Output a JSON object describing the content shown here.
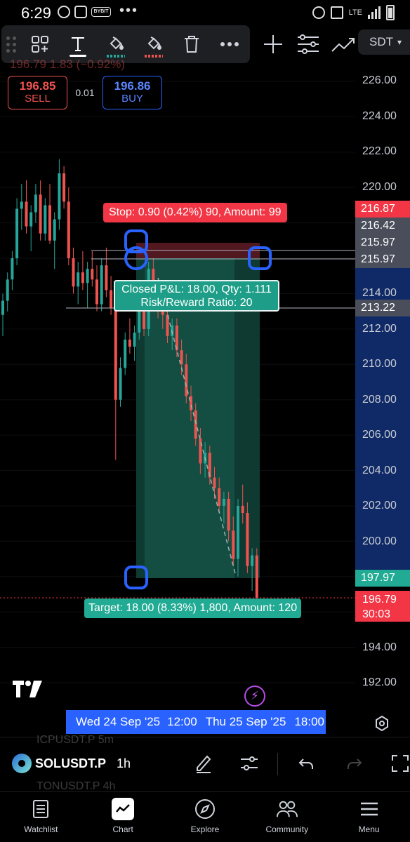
{
  "status_bar": {
    "time": "6:29",
    "carrier_badge": "BYBIT",
    "overflow": "•••",
    "network": "LTE"
  },
  "toolbar": {
    "tools": [
      "grid-add-icon",
      "text-icon",
      "fill-green-icon",
      "fill-red-icon",
      "trash-icon",
      "more-icon"
    ],
    "side_tools": [
      "crosshair-icon",
      "object-tree-icon",
      "drawing-icon"
    ]
  },
  "symbol_tag": {
    "label": "SDT",
    "caret": "▾"
  },
  "ohlc_ghost": "196.79   1.83 (−0.92%)",
  "trade": {
    "sell_price": "196.85",
    "sell_label": "SELL",
    "spread": "0.01",
    "buy_price": "196.86",
    "buy_label": "BUY"
  },
  "position": {
    "stop_label": "Stop: 0.90 (0.42%) 90, Amount: 99",
    "pnl_line1": "Closed P&L: 18.00, Qty: 1.111",
    "pnl_line2": "Risk/Reward Ratio: 20",
    "target_label": "Target: 18.00 (8.33%) 1,800, Amount: 120"
  },
  "price_axis": {
    "ticks": [
      "226.00",
      "224.00",
      "222.00",
      "220.00",
      "214.00",
      "212.00",
      "210.00",
      "208.00",
      "206.00",
      "204.00",
      "202.00",
      "200.00",
      "194.00",
      "192.00"
    ],
    "stop_price": "216.87",
    "upper_price": "216.42",
    "entry_price_1": "215.97",
    "entry_price_2": "215.97",
    "marker_price": "213.22",
    "target_price": "197.97",
    "last_price": "196.79",
    "countdown": "30:03"
  },
  "time_axis": {
    "labels": [
      "Wed 24 Sep '25",
      "12:00",
      "Thu 25 Sep '25",
      "18:00"
    ]
  },
  "symbol_bar": {
    "ghost_top": "ICPUSDT.P   5m",
    "symbol": "SOLUSDT.P",
    "timeframe": "1h",
    "ghost_bottom": "TONUSDT.P   4h"
  },
  "bottom_nav": [
    {
      "label": "Watchlist",
      "icon": "watchlist-icon"
    },
    {
      "label": "Chart",
      "icon": "chart-icon"
    },
    {
      "label": "Explore",
      "icon": "compass-icon"
    },
    {
      "label": "Community",
      "icon": "community-icon"
    },
    {
      "label": "Menu",
      "icon": "menu-icon"
    }
  ],
  "chart_data": {
    "type": "candlestick",
    "symbol": "SOLUSDT.P",
    "timeframe": "1h",
    "ylim": [
      191,
      228
    ],
    "colors": {
      "up": "#26a69a",
      "down": "#ef5350"
    },
    "candles": [
      [
        212.8,
        214.0,
        211.6,
        213.6
      ],
      [
        213.6,
        215.2,
        213.0,
        214.8
      ],
      [
        214.8,
        216.4,
        214.2,
        216.0
      ],
      [
        216.0,
        219.4,
        215.6,
        218.8
      ],
      [
        218.8,
        220.2,
        217.6,
        219.2
      ],
      [
        219.2,
        220.4,
        217.4,
        217.8
      ],
      [
        217.8,
        219.0,
        216.4,
        218.6
      ],
      [
        218.6,
        220.2,
        218.0,
        219.6
      ],
      [
        219.6,
        220.4,
        217.0,
        217.4
      ],
      [
        217.4,
        219.4,
        217.0,
        219.0
      ],
      [
        219.0,
        220.2,
        216.8,
        217.0
      ],
      [
        217.0,
        218.6,
        215.4,
        218.2
      ],
      [
        218.2,
        221.6,
        217.6,
        220.8
      ],
      [
        220.8,
        221.2,
        218.8,
        219.2
      ],
      [
        219.2,
        220.0,
        215.6,
        216.0
      ],
      [
        216.0,
        216.6,
        214.0,
        214.4
      ],
      [
        214.4,
        215.8,
        213.4,
        215.2
      ],
      [
        215.2,
        216.4,
        214.2,
        214.6
      ],
      [
        214.6,
        215.8,
        213.2,
        215.4
      ],
      [
        215.4,
        216.4,
        214.4,
        214.8
      ],
      [
        214.8,
        215.6,
        213.0,
        213.4
      ],
      [
        213.4,
        216.0,
        213.0,
        215.6
      ],
      [
        215.6,
        216.6,
        213.8,
        214.2
      ],
      [
        214.2,
        215.0,
        212.8,
        213.2
      ],
      [
        213.2,
        214.0,
        204.6,
        208.0
      ],
      [
        208.0,
        210.4,
        207.6,
        209.8
      ],
      [
        209.8,
        211.8,
        209.4,
        211.4
      ],
      [
        211.4,
        212.6,
        210.6,
        211.0
      ],
      [
        211.0,
        212.2,
        210.2,
        211.8
      ],
      [
        211.8,
        213.8,
        211.4,
        213.4
      ],
      [
        213.4,
        214.2,
        211.6,
        212.0
      ],
      [
        212.0,
        215.8,
        211.6,
        215.4
      ],
      [
        215.4,
        216.0,
        213.6,
        214.0
      ],
      [
        214.0,
        214.6,
        212.6,
        213.0
      ],
      [
        213.0,
        213.6,
        212.0,
        212.8
      ],
      [
        212.8,
        213.4,
        211.2,
        211.6
      ],
      [
        211.6,
        212.6,
        210.8,
        212.2
      ],
      [
        212.2,
        212.6,
        210.4,
        210.8
      ],
      [
        210.8,
        211.4,
        209.4,
        210.0
      ],
      [
        210.0,
        210.6,
        207.8,
        208.2
      ],
      [
        208.2,
        208.8,
        206.8,
        207.4
      ],
      [
        207.4,
        207.8,
        205.4,
        205.8
      ],
      [
        205.8,
        206.4,
        203.8,
        204.4
      ],
      [
        204.4,
        205.6,
        203.6,
        205.0
      ],
      [
        205.0,
        205.4,
        203.2,
        203.6
      ],
      [
        203.6,
        204.2,
        202.4,
        203.0
      ],
      [
        203.0,
        203.6,
        201.6,
        202.0
      ],
      [
        202.0,
        202.8,
        201.0,
        202.4
      ],
      [
        202.4,
        202.8,
        200.0,
        200.6
      ],
      [
        200.6,
        201.4,
        198.6,
        199.0
      ],
      [
        199.0,
        202.4,
        198.0,
        202.0
      ],
      [
        202.0,
        203.2,
        201.0,
        201.6
      ],
      [
        201.6,
        202.2,
        198.2,
        198.6
      ],
      [
        198.6,
        199.6,
        197.2,
        199.2
      ],
      [
        199.2,
        199.6,
        196.6,
        196.79
      ]
    ]
  }
}
